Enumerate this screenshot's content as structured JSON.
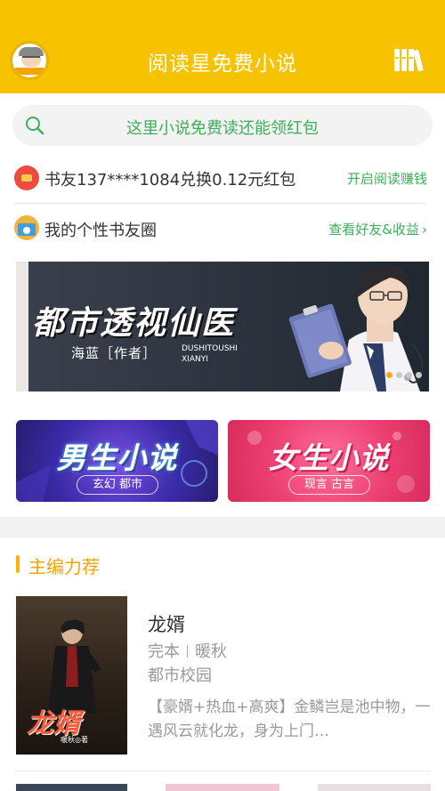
{
  "header": {
    "title": "阅读星免费小说",
    "background_color": "#f7c200",
    "avatar_icon": "avatar-icon",
    "shelf_icon": "bookshelf-icon"
  },
  "search": {
    "placeholder_text": "这里小说免费读还能领红包",
    "icon": "search-icon",
    "text_color": "#3fae5a"
  },
  "notice": {
    "text": "书友137****1084兑换0.12元红包",
    "link": "开启阅读赚钱",
    "icon": "red-packet-icon"
  },
  "circle": {
    "text": "我的个性书友圈",
    "link": "查看好友&收益",
    "chevron": "›",
    "icon": "book-circle-icon"
  },
  "banner": {
    "title": "都市透视仙医",
    "author": "海蓝［作者］",
    "pinyin_line1": "DUSHITOUSHI",
    "pinyin_line2": "XIANYI",
    "active_slide": 1,
    "slide_count": 4
  },
  "categories": [
    {
      "title": "男生小说",
      "subtitle": "玄幻 都市"
    },
    {
      "title": "女生小说",
      "subtitle": "现言 古言"
    }
  ],
  "section": {
    "title": "主编力荐",
    "accent_color": "#f0a500"
  },
  "book": {
    "name": "龙婿",
    "status": "完本",
    "author": "暖秋",
    "category": "都市校园",
    "description": "【豪婿+热血+高爽】金鳞岂是池中物，一遇风云就化龙，身为上门…",
    "cover_title": "龙婿",
    "cover_author": "暖秋◎著"
  }
}
